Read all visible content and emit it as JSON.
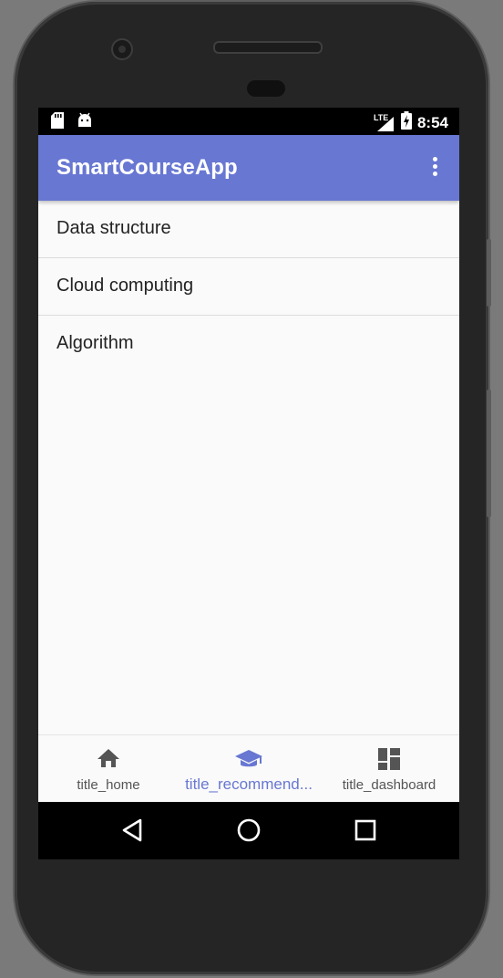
{
  "status_bar": {
    "time": "8:54",
    "network_label": "LTE",
    "icons": [
      "sd-card-icon",
      "android-icon",
      "lte-signal-icon",
      "battery-charging-icon"
    ]
  },
  "app_bar": {
    "title": "SmartCourseApp",
    "overflow_icon": "more-vert-icon"
  },
  "courses": [
    {
      "label": "Data structure"
    },
    {
      "label": "Cloud computing"
    },
    {
      "label": "Algorithm"
    }
  ],
  "bottom_nav": {
    "items": [
      {
        "label": "title_home",
        "icon": "home-icon",
        "active": false
      },
      {
        "label": "title_recommend...",
        "icon": "school-icon",
        "active": true
      },
      {
        "label": "title_dashboard",
        "icon": "dashboard-icon",
        "active": false
      }
    ]
  },
  "system_nav": {
    "icons": [
      "back-icon",
      "home-circle-icon",
      "recents-icon"
    ]
  },
  "colors": {
    "primary": "#6877d2",
    "background": "#fafafa",
    "inactive_nav": "#555555"
  }
}
